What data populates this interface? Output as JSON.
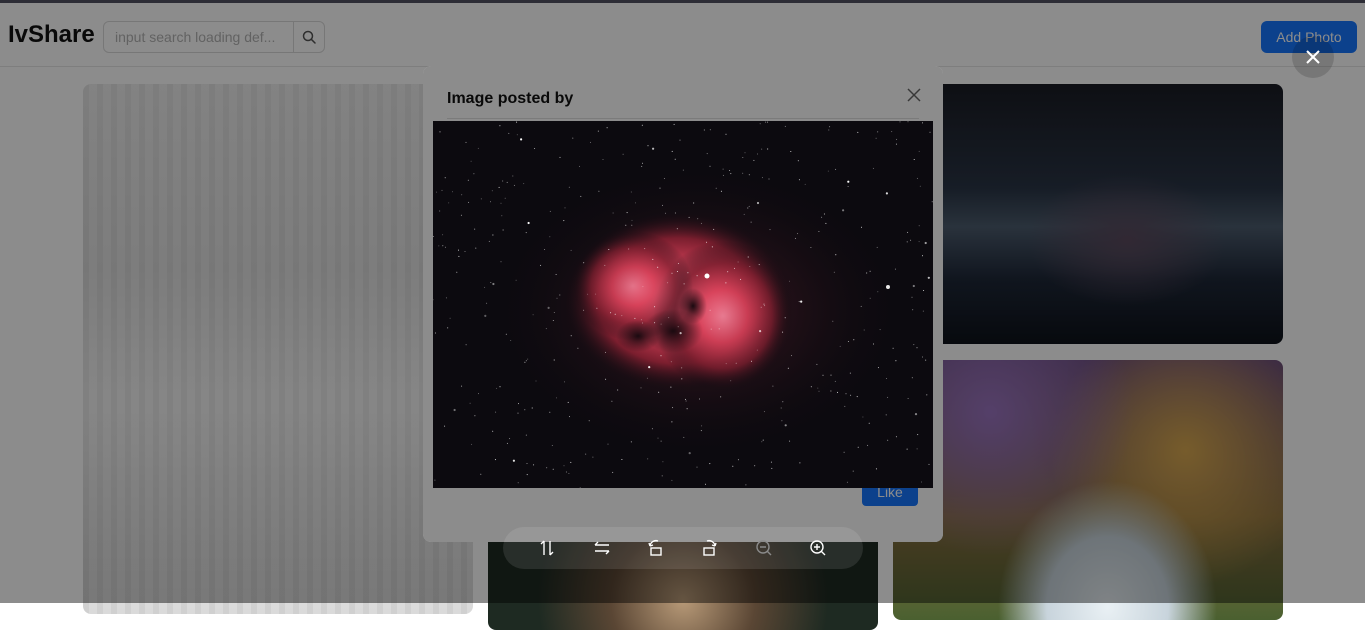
{
  "header": {
    "logo": "IvShare",
    "search_placeholder": "input search loading def...",
    "add_photo_label": "Add Photo"
  },
  "modal": {
    "title": "Image posted by",
    "like_label": "Like"
  },
  "preview": {
    "image_description": "red emission nebula star field",
    "toolbar": [
      "flip-vertical-icon",
      "flip-horizontal-icon",
      "rotate-left-icon",
      "rotate-right-icon",
      "zoom-out-icon",
      "zoom-in-icon"
    ]
  },
  "colors": {
    "accent": "#1677ff",
    "overlay": "rgba(0,0,0,0.45)",
    "nebula": "#d8425a"
  }
}
